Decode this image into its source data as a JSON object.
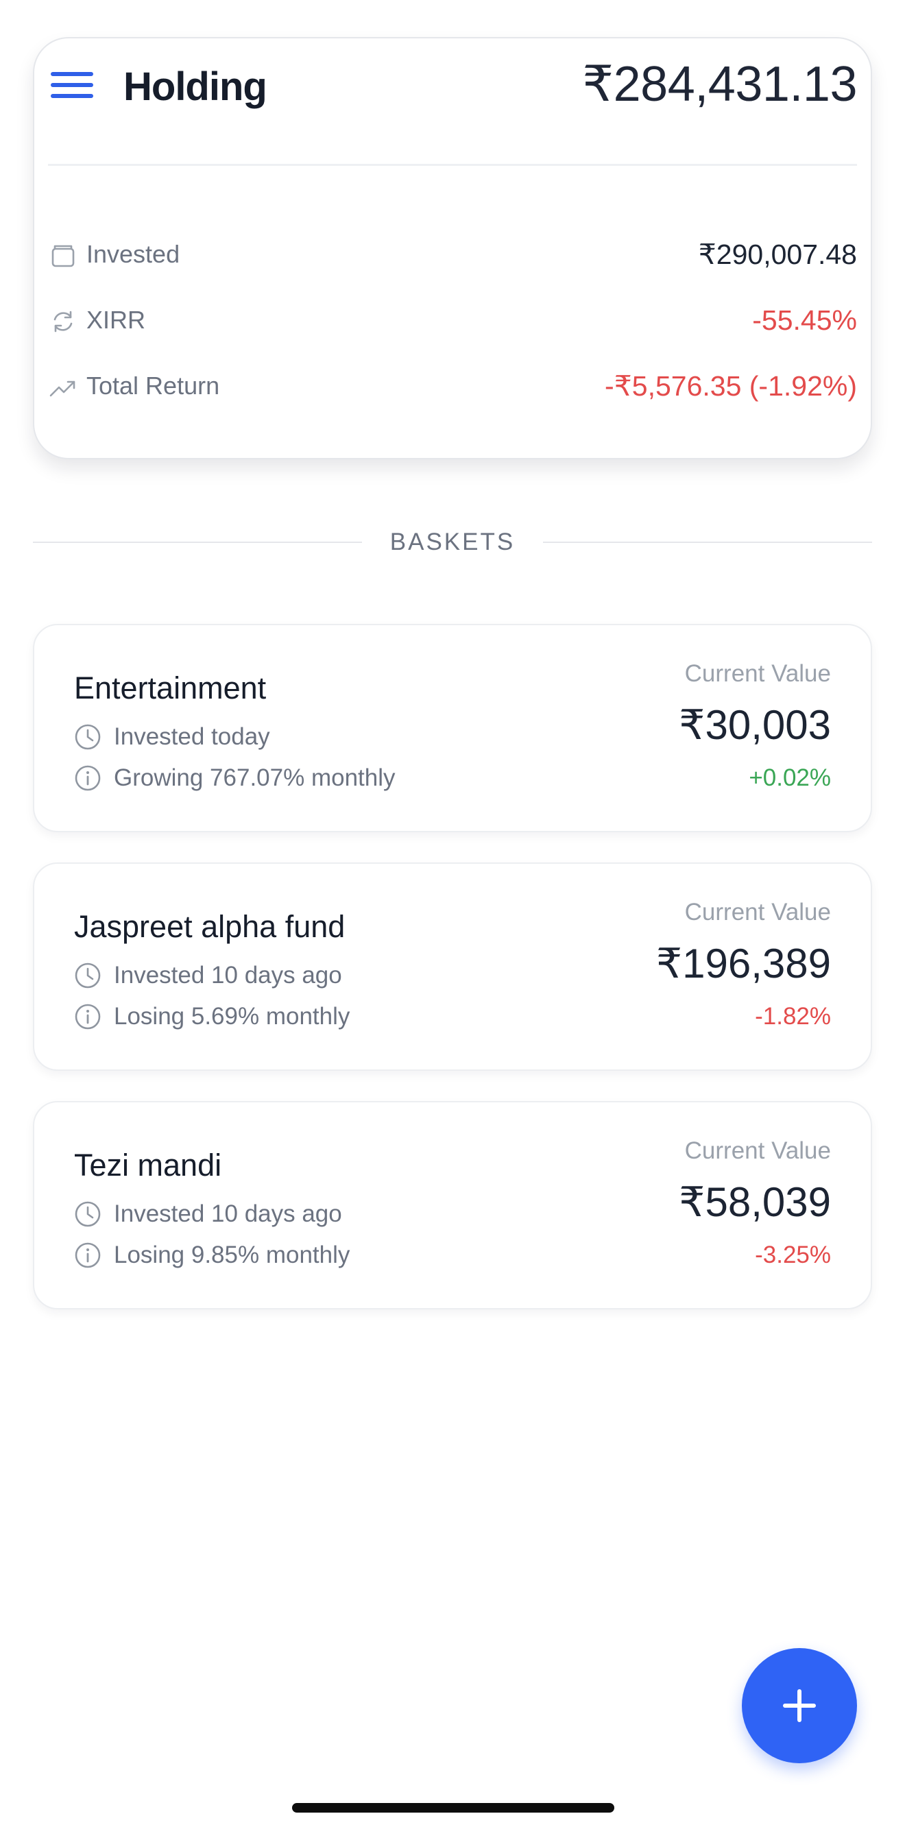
{
  "summary": {
    "title": "Holding",
    "total_value": "₹284,431.13",
    "stats": [
      {
        "icon": "wallet-icon",
        "label": "Invested",
        "value": "₹290,007.48"
      },
      {
        "icon": "refresh-icon",
        "label": "XIRR",
        "value": "-55.45%"
      },
      {
        "icon": "trending-up-icon",
        "label": "Total Return",
        "value": "-₹5,576.35 (-1.92%)"
      }
    ]
  },
  "baskets_heading": "BASKETS",
  "baskets": [
    {
      "name": "Entertainment",
      "invested": "Invested today",
      "growth": "Growing 767.07% monthly",
      "current_value_label": "Current Value",
      "current_value": "₹30,003",
      "change": "+0.02%"
    },
    {
      "name": "Jaspreet alpha fund",
      "invested": "Invested 10 days ago",
      "growth": "Losing 5.69% monthly",
      "current_value_label": "Current Value",
      "current_value": "₹196,389",
      "change": "-1.82%"
    },
    {
      "name": "Tezi mandi",
      "invested": "Invested 10 days ago",
      "growth": "Losing 9.85% monthly",
      "current_value_label": "Current Value",
      "current_value": "₹58,039",
      "change": "-3.25%"
    }
  ],
  "fab": {
    "icon": "plus-icon"
  },
  "colors": {
    "accent": "#2f63f5",
    "negative": "#e34b4b",
    "positive": "#3aa655",
    "muted": "#6b7280"
  }
}
